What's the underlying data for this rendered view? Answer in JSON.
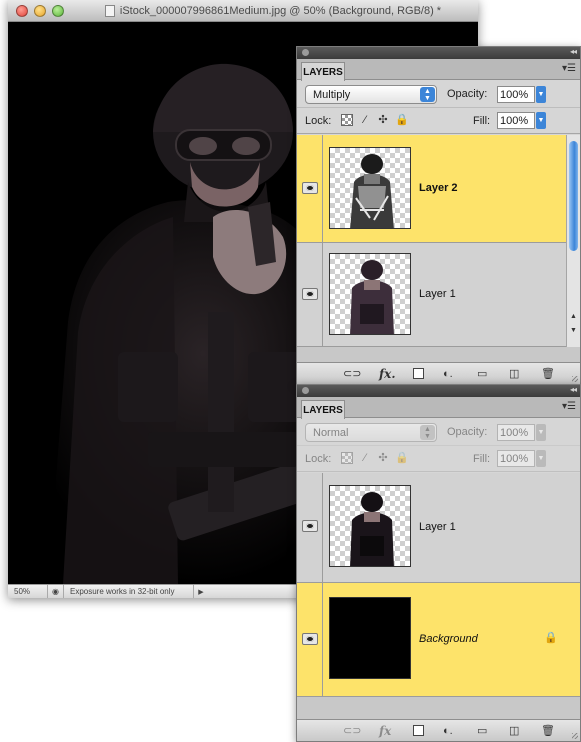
{
  "document_window": {
    "title": "iStock_000007996861Medium.jpg @ 50% (Background, RGB/8) *",
    "status": {
      "zoom": "50%",
      "info": "Exposure works in 32-bit only"
    }
  },
  "layers_panel_top": {
    "tab": "LAYERS",
    "blend_mode": "Multiply",
    "opacity_label": "Opacity:",
    "opacity_value": "100%",
    "lock_label": "Lock:",
    "fill_label": "Fill:",
    "fill_value": "100%",
    "layers": [
      {
        "name": "Layer 2",
        "selected": true,
        "visible": true
      },
      {
        "name": "Layer 1",
        "selected": false,
        "visible": true
      }
    ],
    "accent_color": "#3c85d8",
    "selected_color": "#fde36a"
  },
  "layers_panel_bottom": {
    "tab": "LAYERS",
    "blend_mode": "Normal",
    "opacity_label": "Opacity:",
    "opacity_value": "100%",
    "lock_label": "Lock:",
    "fill_label": "Fill:",
    "fill_value": "100%",
    "layers": [
      {
        "name": "Layer 1",
        "selected": false,
        "visible": true
      },
      {
        "name": "Background",
        "selected": true,
        "visible": true,
        "locked": true
      }
    ]
  },
  "icons": {
    "eye": "eye-icon",
    "link": "link-layers-icon",
    "fx": "fx-icon",
    "mask": "add-mask-icon",
    "adjustment": "adjustment-layer-icon",
    "group": "folder-icon",
    "new_layer": "new-layer-icon",
    "trash": "trash-icon",
    "lock": "lock-icon"
  }
}
